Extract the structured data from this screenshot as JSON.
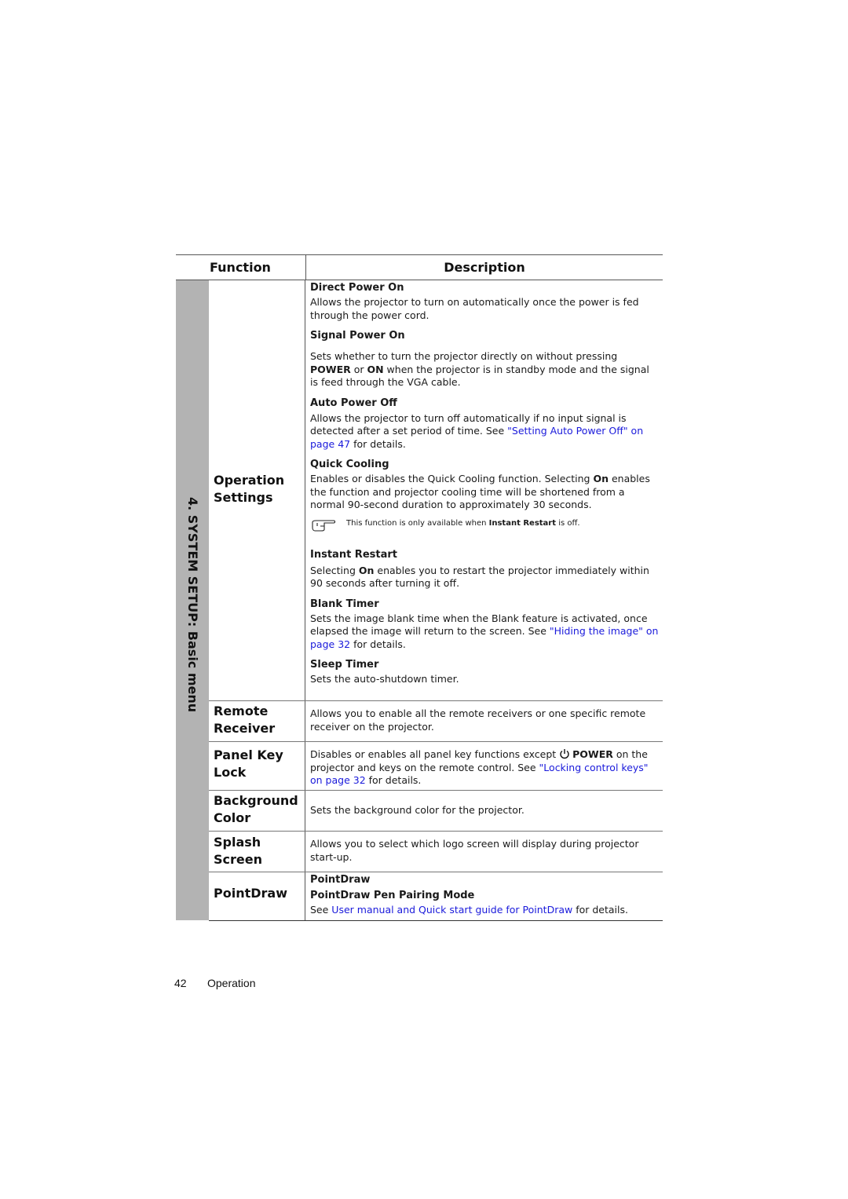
{
  "table": {
    "headers": {
      "function": "Function",
      "description": "Description"
    },
    "section_label": "4. SYSTEM SETUP: Basic menu",
    "rows": [
      {
        "function": [
          "Operation",
          "Settings"
        ],
        "items": [
          {
            "title": "Direct Power On",
            "text": "Allows the projector to turn on automatically once the power is fed through the power cord."
          },
          {
            "title": "Signal Power On",
            "text_parts": [
              "Sets whether to turn the projector directly on without pressing ",
              "POWER",
              " or ",
              "ON",
              " when the projector is in standby mode and the signal is feed through the VGA cable."
            ]
          },
          {
            "title": "Auto Power Off",
            "text_before": "Allows the projector to turn off automatically if no input signal is detected after a set period of time. See ",
            "link": "\"Setting Auto Power Off\" on page 47",
            "text_after": " for details."
          },
          {
            "title": "Quick Cooling",
            "text_parts": [
              "Enables or disables the Quick Cooling function. Selecting ",
              "On",
              " enables the function and projector cooling time will be shortened from a normal 90-second duration to approximately 30 seconds."
            ],
            "note": {
              "icon": "pointing-hand-icon",
              "before": "This function is only available when ",
              "bold": "Instant Restart",
              "after": " is off."
            }
          },
          {
            "title": "Instant Restart",
            "text_parts": [
              "Selecting ",
              "On",
              " enables you to restart the projector immediately within 90 seconds after turning it off."
            ]
          },
          {
            "title": "Blank Timer",
            "text_before": "Sets the image blank time when the Blank feature is activated, once elapsed the image will return to the screen. See ",
            "link": "\"Hiding the image\" on page 32",
            "text_after": " for details."
          },
          {
            "title": "Sleep Timer",
            "text": "Sets the auto-shutdown timer."
          }
        ]
      },
      {
        "function": [
          "Remote",
          "Receiver"
        ],
        "text": "Allows you to enable all the remote receivers or one specific remote receiver on the projector."
      },
      {
        "function": [
          "Panel Key",
          "Lock"
        ],
        "text_before": "Disables or enables all panel key functions except ",
        "icon": "power-icon",
        "bold": "POWER",
        "text_mid": " on the projector and keys on the remote control. See ",
        "link": "\"Locking control keys\" on page 32",
        "text_after": " for details."
      },
      {
        "function": [
          "Background",
          "Color"
        ],
        "text": "Sets the background color for the projector."
      },
      {
        "function": [
          "Splash",
          "Screen"
        ],
        "text": "Allows you to select which logo screen will display during projector start-up."
      },
      {
        "function": [
          "PointDraw"
        ],
        "titles": [
          "PointDraw",
          "PointDraw Pen Pairing Mode"
        ],
        "text_before": "See ",
        "link": "User manual and Quick start guide for PointDraw",
        "text_after": " for details."
      }
    ]
  },
  "footer": {
    "page_number": "42",
    "section": "Operation"
  },
  "colors": {
    "link": "#1a1adb",
    "sidebar": "#b3b3b3"
  }
}
